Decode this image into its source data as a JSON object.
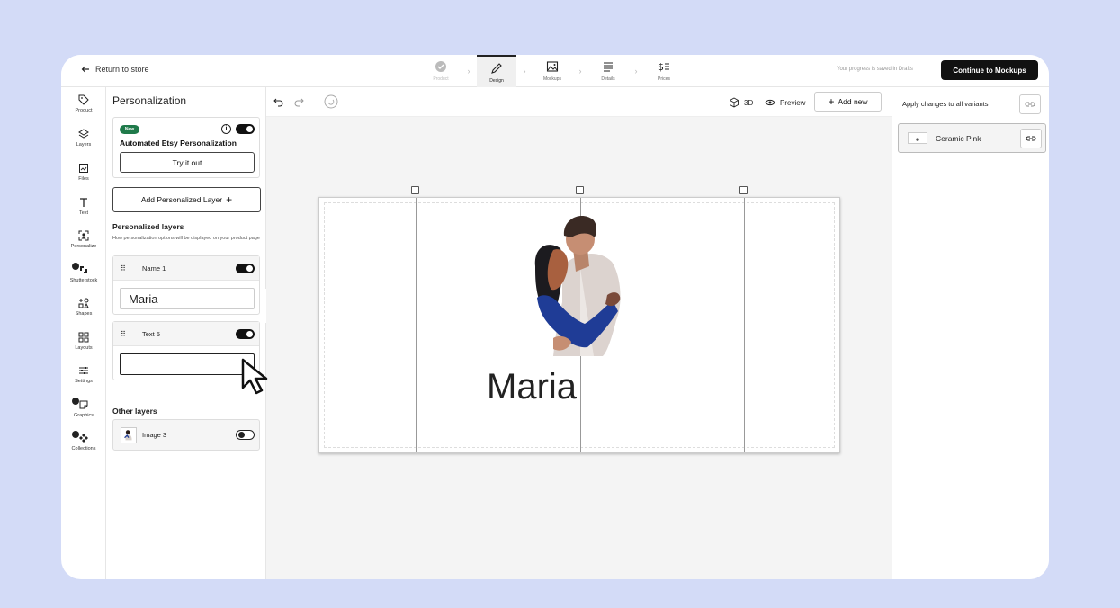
{
  "topbar": {
    "back_label": "Return to store",
    "steps": [
      {
        "label": "Product",
        "icon": "check-circle-icon",
        "state": "disabled"
      },
      {
        "label": "Design",
        "icon": "pencil-icon",
        "state": "active"
      },
      {
        "label": "Mockups",
        "icon": "image-icon",
        "state": "normal"
      },
      {
        "label": "Details",
        "icon": "lines-icon",
        "state": "normal"
      },
      {
        "label": "Prices",
        "icon": "dollar-list-icon",
        "state": "normal"
      }
    ],
    "saved_text": "Your progress is saved in Drafts",
    "continue_label": "Continue to Mockups"
  },
  "rail": {
    "items": [
      {
        "label": "Product",
        "icon": "tag-icon"
      },
      {
        "label": "Layers",
        "icon": "layers-icon"
      },
      {
        "label": "Files",
        "icon": "files-icon"
      },
      {
        "label": "Text",
        "icon": "text-icon"
      },
      {
        "label": "Personalize",
        "icon": "personalize-icon"
      },
      {
        "label": "Shutterstock",
        "icon": "shutterstock-icon"
      },
      {
        "label": "Shapes",
        "icon": "shapes-icon"
      },
      {
        "label": "Layouts",
        "icon": "layouts-icon"
      },
      {
        "label": "Settings",
        "icon": "sliders-icon"
      },
      {
        "label": "Graphics",
        "icon": "graphics-icon"
      },
      {
        "label": "Collections",
        "icon": "collections-icon"
      }
    ]
  },
  "panel": {
    "title": "Personalization",
    "auto": {
      "badge": "New",
      "title": "Automated Etsy Personalization",
      "info": "i",
      "try_label": "Try it out"
    },
    "add_layer_label": "Add Personalized Layer",
    "add_layer_plus": "+",
    "personalized_heading": "Personalized layers",
    "personalized_sub": "How personalization options will be displayed on your product page",
    "layers": [
      {
        "name": "Name 1",
        "value": "Maria",
        "enabled": true
      },
      {
        "name": "Text 5",
        "value": "",
        "enabled": true
      }
    ],
    "other_heading": "Other layers",
    "other_layers": [
      {
        "name": "Image 3",
        "enabled": false
      }
    ],
    "collapse_glyph": "‹"
  },
  "canvas": {
    "tool_3d": "3D",
    "tool_preview": "Preview",
    "add_new_label": "Add new",
    "add_new_plus": "+",
    "text_content": "Maria"
  },
  "right": {
    "apply_label": "Apply changes to all variants",
    "variant_name": "Ceramic Pink"
  },
  "colors": {
    "background": "#d3dbf7",
    "primary_button": "#111111",
    "new_badge": "#1f7a4a",
    "hug_jacket_blue": "#1f3c96"
  }
}
